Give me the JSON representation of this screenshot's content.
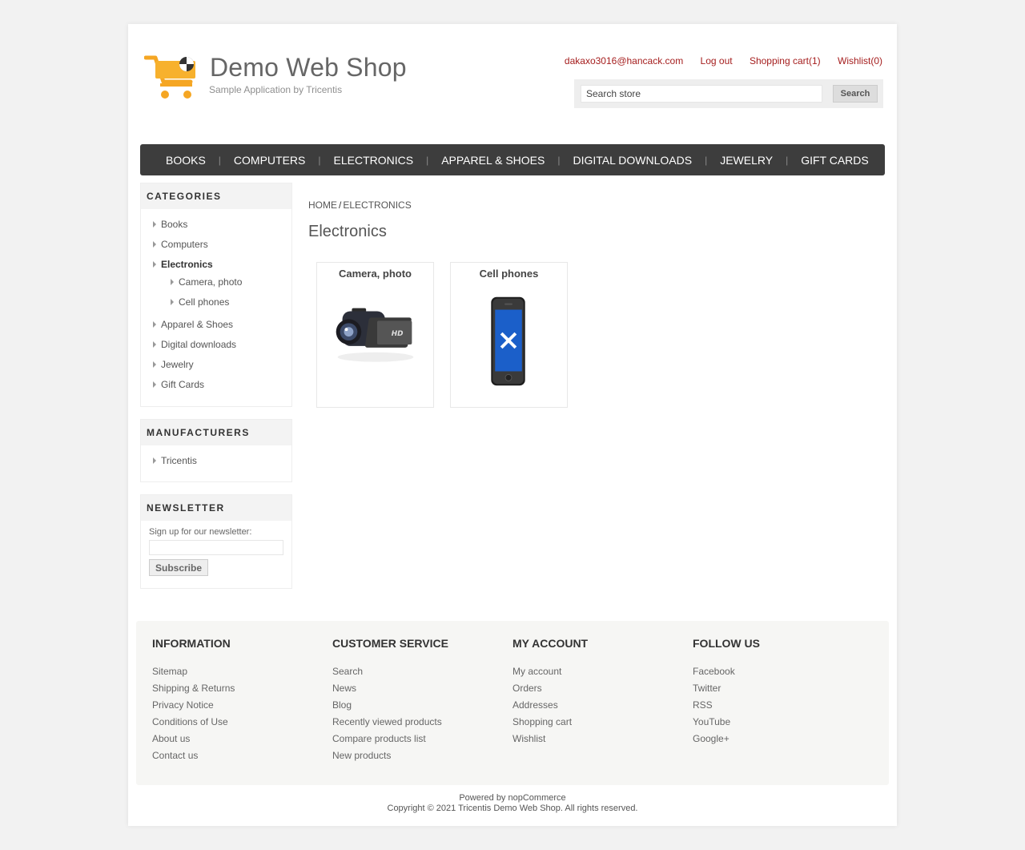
{
  "header": {
    "logo_title": "Demo Web Shop",
    "logo_subtitle": "Sample Application by Tricentis",
    "links": {
      "account": "dakaxo3016@hancack.com",
      "logout": "Log out",
      "cart": "Shopping cart(1)",
      "wishlist": "Wishlist(0)"
    },
    "search": {
      "value": "Search store",
      "button": "Search"
    },
    "link_color": "#a51e1e"
  },
  "menu": {
    "items": [
      "BOOKS",
      "COMPUTERS",
      "ELECTRONICS",
      "APPAREL & SHOES",
      "DIGITAL DOWNLOADS",
      "JEWELRY",
      "GIFT CARDS"
    ],
    "background": "#3d3d3d"
  },
  "sidebar": {
    "categories": {
      "title": "CATEGORIES",
      "items": [
        "Books",
        "Computers",
        "Electronics",
        "Camera, photo",
        "Cell phones",
        "Apparel & Shoes",
        "Digital downloads",
        "Jewelry",
        "Gift Cards"
      ],
      "active": "Electronics"
    },
    "manufacturers": {
      "title": "MANUFACTURERS",
      "items": [
        "Tricentis"
      ]
    },
    "newsletter": {
      "title": "NEWSLETTER",
      "label": "Sign up for our newsletter:",
      "input_value": "",
      "button": "Subscribe"
    }
  },
  "main": {
    "breadcrumb": {
      "home": "HOME",
      "separator": "/",
      "current": "ELECTRONICS"
    },
    "title": "Electronics",
    "subcategories": [
      {
        "title": "Camera, photo",
        "icon": "camcorder-image"
      },
      {
        "title": "Cell phones",
        "icon": "smartphone-image"
      }
    ]
  },
  "footer": {
    "columns": [
      {
        "title": "INFORMATION",
        "items": [
          "Sitemap",
          "Shipping & Returns",
          "Privacy Notice",
          "Conditions of Use",
          "About us",
          "Contact us"
        ]
      },
      {
        "title": "CUSTOMER SERVICE",
        "items": [
          "Search",
          "News",
          "Blog",
          "Recently viewed products",
          "Compare products list",
          "New products"
        ]
      },
      {
        "title": "MY ACCOUNT",
        "items": [
          "My account",
          "Orders",
          "Addresses",
          "Shopping cart",
          "Wishlist"
        ]
      },
      {
        "title": "FOLLOW US",
        "items": [
          "Facebook",
          "Twitter",
          "RSS",
          "YouTube",
          "Google+"
        ]
      }
    ],
    "powered": "Powered by nopCommerce",
    "copyright": "Copyright © 2021 Tricentis Demo Web Shop. All rights reserved."
  }
}
